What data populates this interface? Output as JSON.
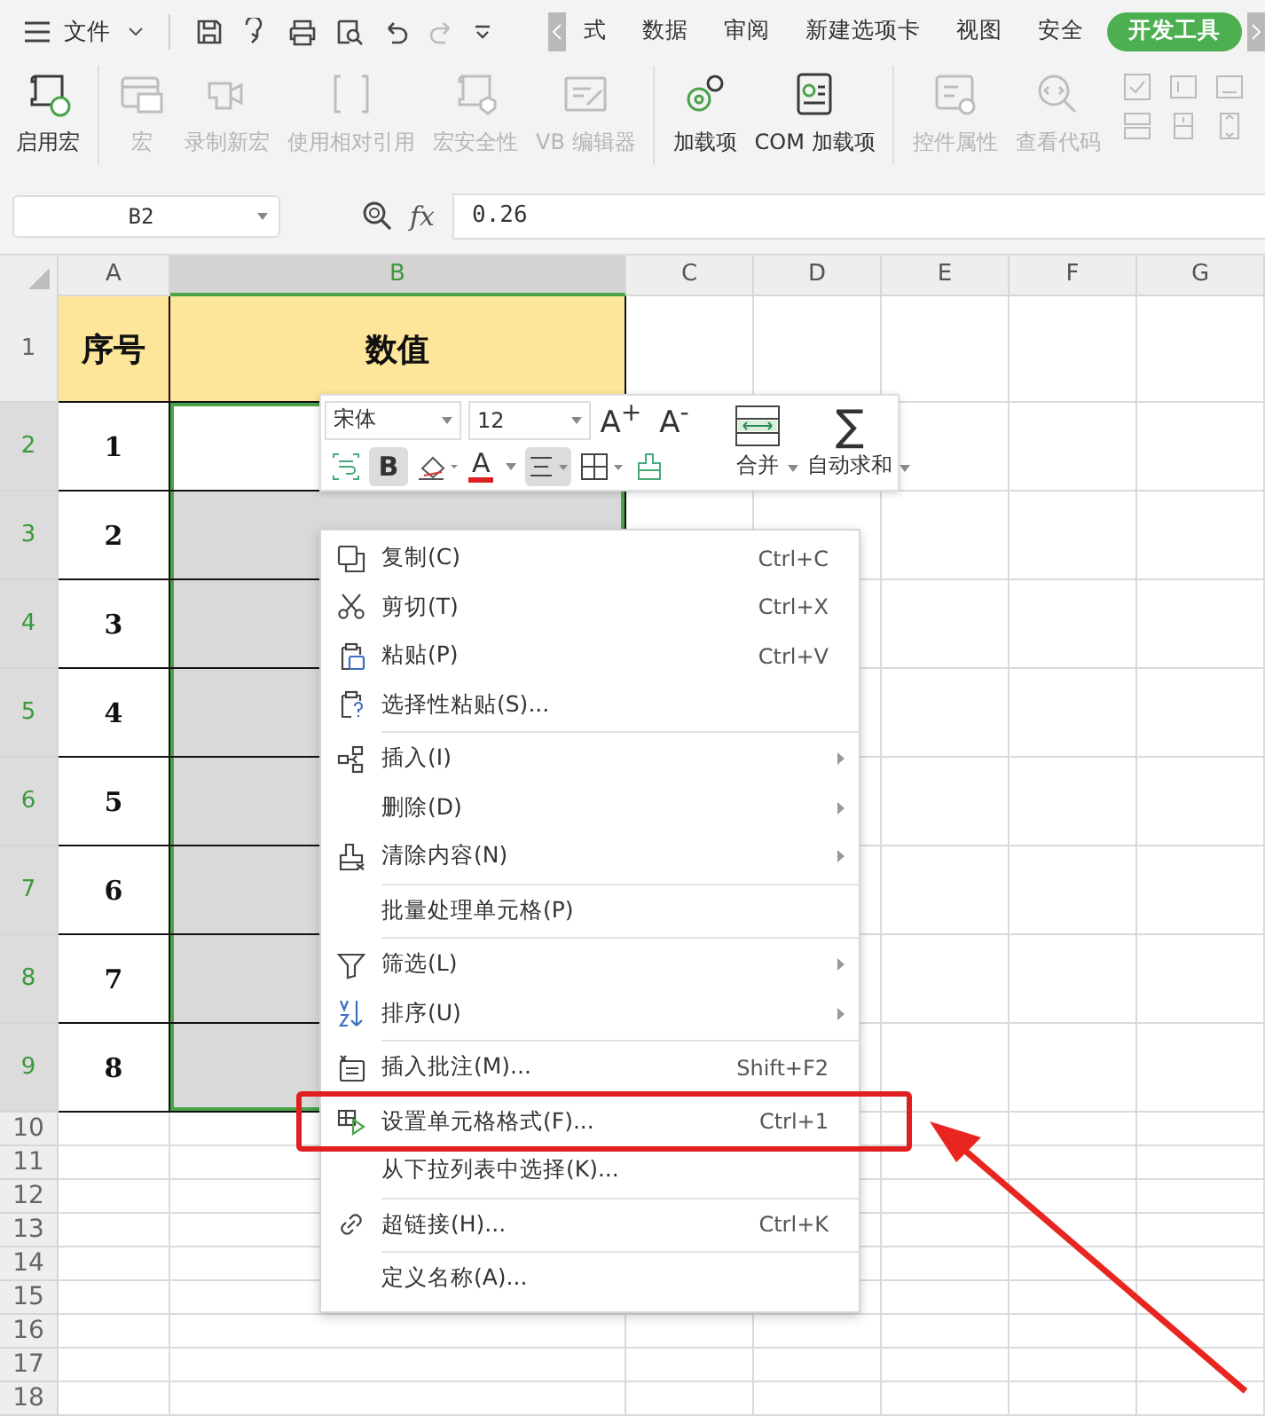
{
  "title_bar": {
    "file_menu": "文件"
  },
  "tabs": [
    {
      "label": "式",
      "selected": false
    },
    {
      "label": "数据",
      "selected": false
    },
    {
      "label": "审阅",
      "selected": false
    },
    {
      "label": "新建选项卡",
      "selected": false
    },
    {
      "label": "视图",
      "selected": false
    },
    {
      "label": "安全",
      "selected": false
    },
    {
      "label": "开发工具",
      "selected": true
    }
  ],
  "ribbon": [
    {
      "label": "启用宏",
      "disabled": false
    },
    {
      "label": "宏",
      "disabled": true
    },
    {
      "label": "录制新宏",
      "disabled": true
    },
    {
      "label": "使用相对引用",
      "disabled": true
    },
    {
      "label": "宏安全性",
      "disabled": true
    },
    {
      "label": "VB 编辑器",
      "disabled": true
    },
    {
      "label": "加载项",
      "disabled": false
    },
    {
      "label": "COM 加载项",
      "disabled": false
    },
    {
      "label": "控件属性",
      "disabled": true
    },
    {
      "label": "查看代码",
      "disabled": true
    }
  ],
  "formula_bar": {
    "name_box": "B2",
    "fx": "fx",
    "value": "0.26"
  },
  "columns": [
    {
      "label": "A",
      "selected": false
    },
    {
      "label": "B",
      "selected": true
    },
    {
      "label": "C",
      "selected": false
    },
    {
      "label": "D",
      "selected": false
    },
    {
      "label": "E",
      "selected": false
    },
    {
      "label": "F",
      "selected": false
    },
    {
      "label": "G",
      "selected": false
    }
  ],
  "rows": [
    {
      "header": "1",
      "selected": false,
      "a": "序号",
      "b": "数值"
    },
    {
      "header": "2",
      "selected": true,
      "a": "1",
      "active": true
    },
    {
      "header": "3",
      "selected": true,
      "a": "2"
    },
    {
      "header": "4",
      "selected": true,
      "a": "3"
    },
    {
      "header": "5",
      "selected": true,
      "a": "4"
    },
    {
      "header": "6",
      "selected": true,
      "a": "5"
    },
    {
      "header": "7",
      "selected": true,
      "a": "6"
    },
    {
      "header": "8",
      "selected": true,
      "a": "7"
    },
    {
      "header": "9",
      "selected": true,
      "a": "8"
    },
    {
      "header": "10",
      "selected": false
    },
    {
      "header": "11",
      "selected": false
    },
    {
      "header": "12",
      "selected": false
    },
    {
      "header": "13",
      "selected": false
    },
    {
      "header": "14",
      "selected": false
    },
    {
      "header": "15",
      "selected": false
    },
    {
      "header": "16",
      "selected": false
    },
    {
      "header": "17",
      "selected": false
    },
    {
      "header": "18",
      "selected": false
    }
  ],
  "mini_toolbar": {
    "font": "宋体",
    "size": "12",
    "grow": "A$^{+}$",
    "shrink": "A$^{-}$",
    "bold": {
      "label": "B",
      "selected": true
    },
    "font_color": "A",
    "align_selected": true,
    "merge": "合并",
    "autosum_symbol": "∑",
    "autosum": "自动求和"
  },
  "context_menu": [
    {
      "label": "复制(C)",
      "shortcut": "Ctrl+C",
      "submenu": false,
      "separator_before": false,
      "highlighted": false
    },
    {
      "label": "剪切(T)",
      "shortcut": "Ctrl+X",
      "submenu": false,
      "separator_before": false,
      "highlighted": false
    },
    {
      "label": "粘贴(P)",
      "shortcut": "Ctrl+V",
      "submenu": false,
      "separator_before": false,
      "highlighted": false
    },
    {
      "label": "选择性粘贴(S)...",
      "submenu": false,
      "separator_before": false,
      "highlighted": false
    },
    {
      "label": "插入(I)",
      "submenu": true,
      "separator_before": true,
      "highlighted": false
    },
    {
      "label": "删除(D)",
      "submenu": true,
      "separator_before": false,
      "highlighted": false
    },
    {
      "label": "清除内容(N)",
      "submenu": true,
      "separator_before": false,
      "highlighted": false
    },
    {
      "label": "批量处理单元格(P)",
      "submenu": false,
      "separator_before": true,
      "highlighted": false
    },
    {
      "label": "筛选(L)",
      "submenu": true,
      "separator_before": true,
      "highlighted": false
    },
    {
      "label": "排序(U)",
      "submenu": true,
      "separator_before": false,
      "highlighted": false
    },
    {
      "label": "插入批注(M)...",
      "shortcut": "Shift+F2",
      "submenu": false,
      "separator_before": true,
      "highlighted": false
    },
    {
      "label": "设置单元格格式(F)...",
      "shortcut": "Ctrl+1",
      "submenu": false,
      "separator_before": true,
      "highlighted": true
    },
    {
      "label": "从下拉列表中选择(K)...",
      "submenu": false,
      "separator_before": false,
      "highlighted": false
    },
    {
      "label": "超链接(H)...",
      "shortcut": "Ctrl+K",
      "submenu": false,
      "separator_before": true,
      "highlighted": false
    },
    {
      "label": "定义名称(A)...",
      "submenu": false,
      "separator_before": true,
      "highlighted": false
    }
  ]
}
